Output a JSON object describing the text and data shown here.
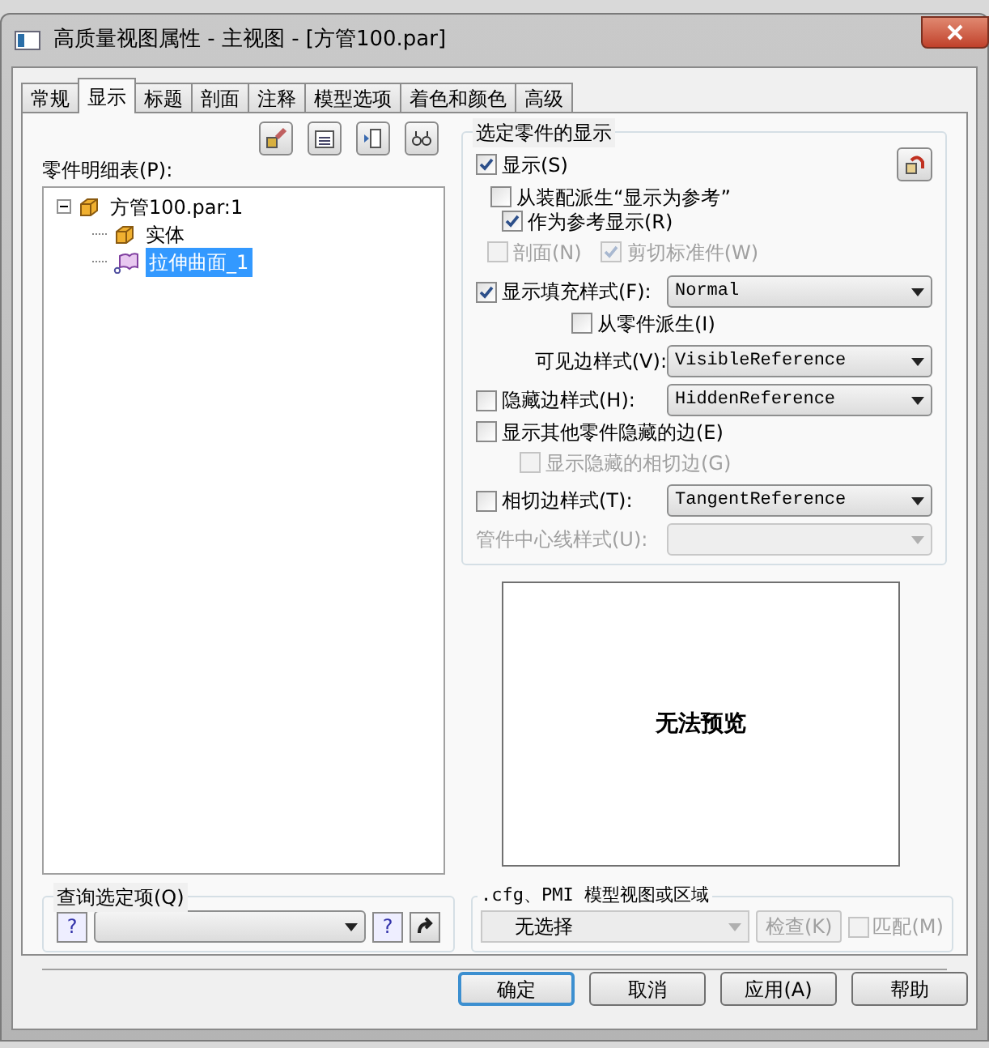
{
  "window": {
    "title": "高质量视图属性 - 主视图 - [方管100.par]"
  },
  "tabs": [
    {
      "label": "常规",
      "selected": false
    },
    {
      "label": "显示",
      "selected": true
    },
    {
      "label": "标题",
      "selected": false
    },
    {
      "label": "剖面",
      "selected": false
    },
    {
      "label": "注释",
      "selected": false
    },
    {
      "label": "模型选项",
      "selected": false
    },
    {
      "label": "着色和颜色",
      "selected": false
    },
    {
      "label": "高级",
      "selected": false
    }
  ],
  "parts_list": {
    "label": "零件明细表(P):",
    "tree": [
      {
        "label": "方管100.par:1",
        "kind": "part",
        "expanded": true,
        "selected": false,
        "children": [
          {
            "label": "实体",
            "kind": "part",
            "selected": false
          },
          {
            "label": "拉伸曲面_1",
            "kind": "surface",
            "selected": true
          }
        ]
      }
    ]
  },
  "display_group": {
    "title": "选定零件的显示",
    "show": {
      "label": "显示(S)",
      "checked": true
    },
    "derive_reference": {
      "label": "从装配派生“显示为参考”",
      "checked": false
    },
    "as_reference": {
      "label": "作为参考显示(R)",
      "checked": true
    },
    "section": {
      "label": "剖面(N)",
      "checked": false,
      "disabled": true
    },
    "cut_standard": {
      "label": "剪切标准件(W)",
      "checked": true,
      "disabled": true
    },
    "fill_style": {
      "label": "显示填充样式(F):",
      "checked": true,
      "value": "Normal"
    },
    "derive_from_part": {
      "label": "从零件派生(I)",
      "checked": false
    },
    "visible_edge": {
      "label": "可见边样式(V):",
      "value": "VisibleReference"
    },
    "hidden_edge": {
      "label": "隐藏边样式(H):",
      "checked": false,
      "value": "HiddenReference"
    },
    "other_hidden": {
      "label": "显示其他零件隐藏的边(E)",
      "checked": false
    },
    "hidden_tangent": {
      "label": "显示隐藏的相切边(G)",
      "checked": false,
      "disabled": true
    },
    "tangent_edge": {
      "label": "相切边样式(T):",
      "checked": false,
      "value": "TangentReference"
    },
    "pipe_centerline": {
      "label": "管件中心线样式(U):",
      "disabled": true
    }
  },
  "preview": {
    "text": "无法预览"
  },
  "query_group": {
    "title": "查询选定项(Q)",
    "query_button": "?",
    "help_button": "?"
  },
  "model_view_group": {
    "title": ".cfg、PMI 模型视图或区域",
    "value": "无选择",
    "check_button": {
      "label": "检查(K)",
      "disabled": true
    },
    "match": {
      "label": "匹配(M)",
      "checked": false,
      "disabled": true
    }
  },
  "buttons": [
    {
      "label": "确定",
      "default": true
    },
    {
      "label": "取消",
      "default": false
    },
    {
      "label": "应用(A)",
      "default": false
    },
    {
      "label": "帮助",
      "default": false
    }
  ]
}
